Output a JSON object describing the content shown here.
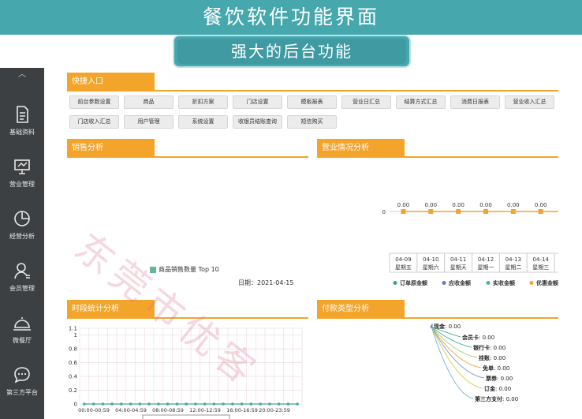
{
  "banner": {
    "title": "餐饮软件功能界面",
    "subtitle": "强大的后台功能"
  },
  "sidebar": {
    "items": [
      {
        "label": "基础资料",
        "icon": "document-icon"
      },
      {
        "label": "营业管理",
        "icon": "presentation-icon"
      },
      {
        "label": "经营分析",
        "icon": "pie-chart-icon"
      },
      {
        "label": "会员管理",
        "icon": "member-icon"
      },
      {
        "label": "微餐厅",
        "icon": "cloche-icon"
      },
      {
        "label": "第三方平台",
        "icon": "chat-icon"
      }
    ]
  },
  "quick": {
    "title": "快捷入口",
    "row1": [
      "前台参数设置",
      "商品",
      "折扣方案",
      "门店设置",
      "模板报表",
      "营业日汇总",
      "结算方式汇总",
      "消费日报表",
      "营业收入汇总"
    ],
    "row2": [
      "门店收入汇总",
      "用户管理",
      "系统设置",
      "收银员结账查询",
      "短信购买"
    ]
  },
  "sales": {
    "title": "销售分析",
    "legend": "商品销售数量 Top 10",
    "date": "日期：2021-04-15",
    "legend_color": "#5fb89a"
  },
  "business": {
    "title": "营业情况分析",
    "y_tick": "0",
    "value_label": "0.00",
    "dates": [
      "04-09",
      "04-10",
      "04-11",
      "04-12",
      "04-13",
      "04-14",
      "04-15"
    ],
    "weekdays": [
      "星期五",
      "星期六",
      "星期天",
      "星期一",
      "星期二",
      "星期三",
      "星期四"
    ],
    "legend": [
      {
        "name": "订单原金额",
        "color": "#3fa08a"
      },
      {
        "name": "应收金额",
        "color": "#5b7fc7"
      },
      {
        "name": "实收金额",
        "color": "#47b6a8"
      },
      {
        "name": "优惠金额",
        "color": "#f3a42b"
      }
    ]
  },
  "period": {
    "title": "时段统计分析",
    "yticks": [
      "1.1",
      "1",
      "0.8",
      "0.6",
      "0.4",
      "0.2",
      "0"
    ],
    "xticks": [
      "00:00-00:59",
      "04:00-04:59",
      "08:00-08:59",
      "12:00-12:59",
      "16:00-16:59",
      "20:00-23:59"
    ]
  },
  "payment": {
    "title": "付款类型分析",
    "items": [
      {
        "name": "现金",
        "value": "0.00"
      },
      {
        "name": "会员卡",
        "value": "0.00"
      },
      {
        "name": "银行卡",
        "value": "0.00"
      },
      {
        "name": "挂账",
        "value": "0.00"
      },
      {
        "name": "免单",
        "value": "0.00"
      },
      {
        "name": "票券",
        "value": "0.00"
      },
      {
        "name": "订金",
        "value": "0.00"
      },
      {
        "name": "第三方支付",
        "value": "0.00"
      }
    ]
  },
  "watermark": "东莞市优客"
}
